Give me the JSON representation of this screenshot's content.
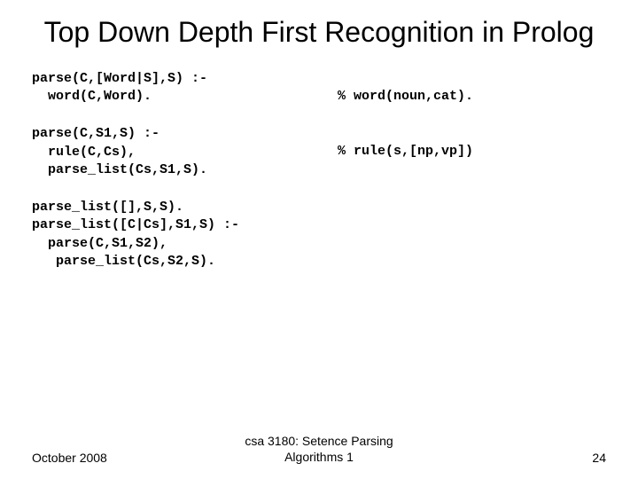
{
  "title": "Top Down Depth First Recognition in Prolog",
  "blocks": {
    "b1_left": "parse(C,[Word|S],S) :-\n  word(C,Word).",
    "b1_right": "% word(noun,cat).",
    "b2_left": "parse(C,S1,S) :-\n  rule(C,Cs),\n  parse_list(Cs,S1,S).",
    "b2_right": "% rule(s,[np,vp])",
    "b3": "parse_list([],S,S).\nparse_list([C|Cs],S1,S) :-\n  parse(C,S1,S2),\n   parse_list(Cs,S2,S)."
  },
  "footer": {
    "left": "October 2008",
    "center": "csa 3180: Setence Parsing Algorithms 1",
    "right": "24"
  }
}
